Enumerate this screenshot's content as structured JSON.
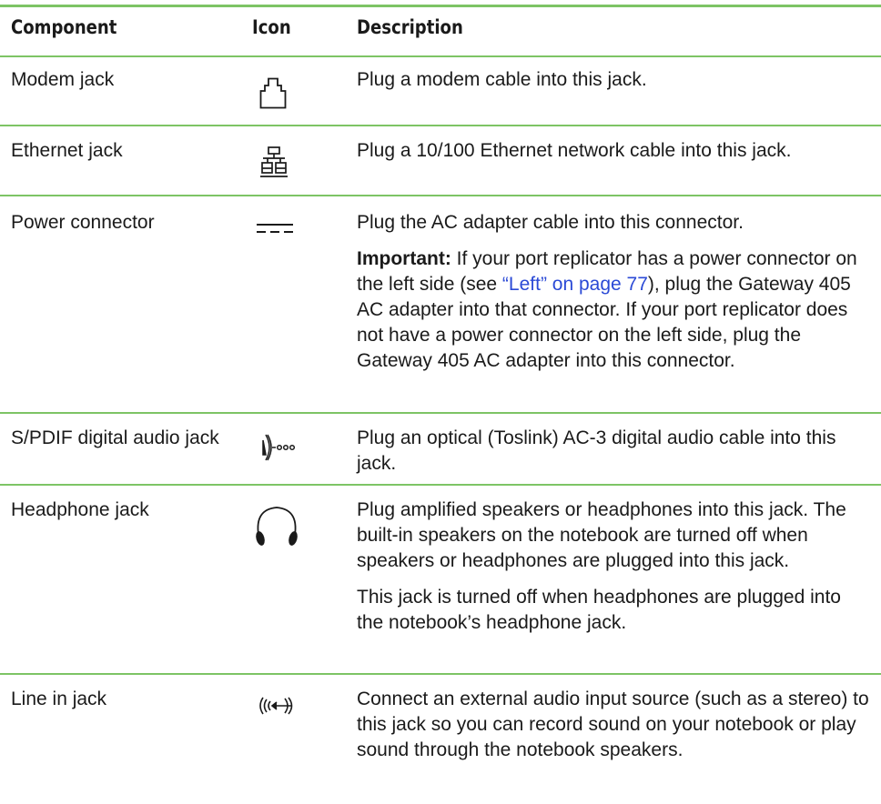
{
  "header": {
    "component": "Component",
    "icon": "Icon",
    "description": "Description"
  },
  "rows": [
    {
      "component": "Modem jack",
      "icon": "modem-jack-icon",
      "description": [
        "Plug a modem cable into this jack."
      ]
    },
    {
      "component": "Ethernet jack",
      "icon": "ethernet-network-icon",
      "description": [
        "Plug a 10/100 Ethernet network cable into this jack."
      ]
    },
    {
      "component": "Power connector",
      "icon": "dc-power-icon",
      "description": [
        "Plug the AC adapter cable into this connector."
      ],
      "important_label": "Important:",
      "important_text_1": " If your port replicator has a power connector on the left side (see ",
      "important_link": "“Left” on page 77",
      "important_text_2": "), plug the Gateway 405 AC adapter into that connector. If your port replicator does not have a power connector on the left side, plug the Gateway 405 AC adapter into this connector."
    },
    {
      "component": "S/PDIF digital audio jack",
      "icon": "spdif-optical-icon",
      "description": [
        "Plug an optical (Toslink) AC-3 digital audio cable into this jack."
      ]
    },
    {
      "component": "Headphone jack",
      "icon": "headphones-icon",
      "description": [
        "Plug amplified speakers or headphones into this jack. The built-in speakers on the notebook are turned off when speakers or headphones are plugged into this jack.",
        "This jack is turned off when headphones are plugged into the notebook’s headphone jack."
      ]
    },
    {
      "component": "Line in jack",
      "icon": "line-in-icon",
      "description": [
        "Connect an external audio input source (such as a stereo) to this jack so you can record sound on your notebook or play sound through the notebook speakers."
      ]
    }
  ],
  "colors": {
    "rule": "#7dc465",
    "link": "#2b4ad6"
  }
}
